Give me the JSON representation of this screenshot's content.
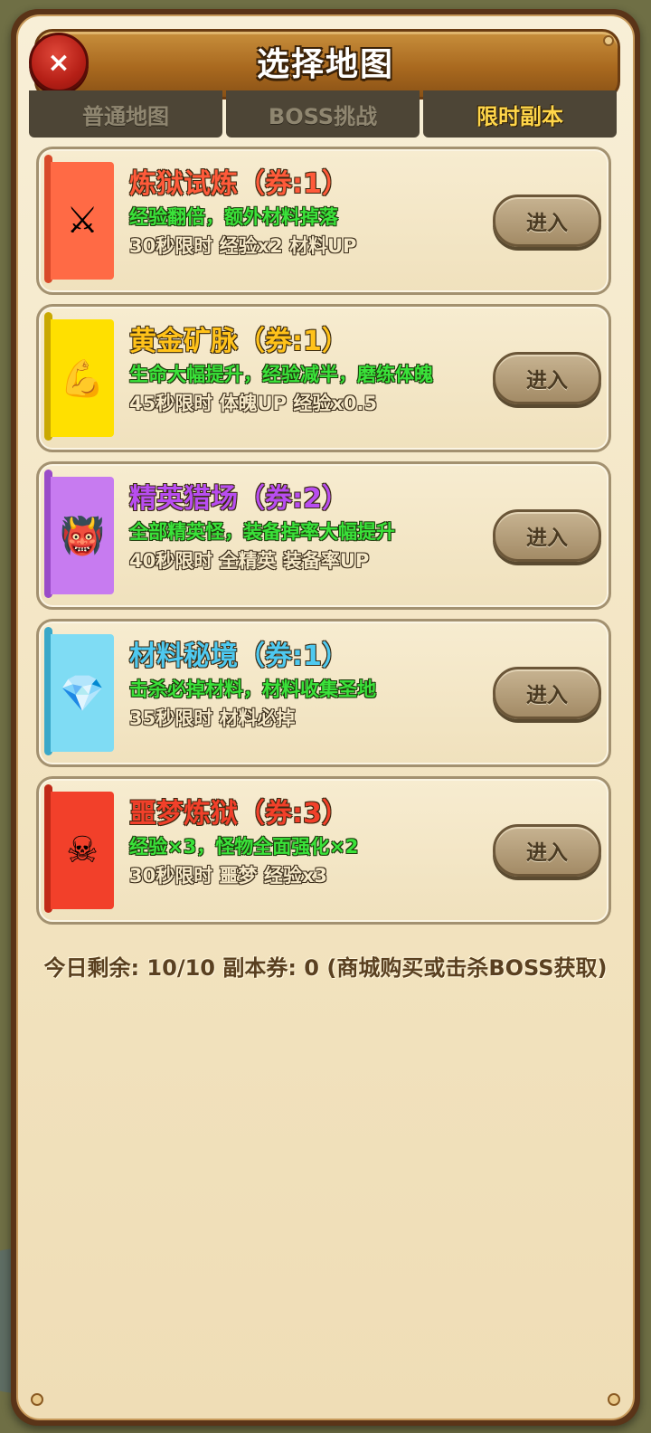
{
  "dialog": {
    "title": "选择地图",
    "close_symbol": "×"
  },
  "tabs": [
    {
      "label": "普通地图",
      "active": false
    },
    {
      "label": "BOSS挑战",
      "active": false
    },
    {
      "label": "限时副本",
      "active": true
    }
  ],
  "dungeons": [
    {
      "title": "炼狱试炼（券:1）",
      "title_color": "#ff5a3a",
      "banner_color": "#ff6a45",
      "stick_color": "#d84a2a",
      "icon": "crossed-swords-icon",
      "icon_glyph": "⚔",
      "description": "经验翻倍，额外材料掉落",
      "meta": "30秒限时 经验x2 材料UP",
      "enter_label": "进入"
    },
    {
      "title": "黄金矿脉（券:1）",
      "title_color": "#ffc21a",
      "banner_color": "#ffe000",
      "stick_color": "#c9a800",
      "icon": "flexed-arm-icon",
      "icon_glyph": "💪",
      "description": "生命大幅提升，经验减半，磨练体魄",
      "meta": "45秒限时 体魄UP 经验x0.5",
      "enter_label": "进入"
    },
    {
      "title": "精英猎场（券:2）",
      "title_color": "#b84df0",
      "banner_color": "#c77bf0",
      "stick_color": "#9a4cc8",
      "icon": "ogre-mask-icon",
      "icon_glyph": "👹",
      "description": "全部精英怪，装备掉率大幅提升",
      "meta": "40秒限时 全精英 装备率UP",
      "enter_label": "进入"
    },
    {
      "title": "材料秘境（券:1）",
      "title_color": "#4ec9f0",
      "banner_color": "#7fdcf4",
      "stick_color": "#3aa8c8",
      "icon": "gem-icon",
      "icon_glyph": "💎",
      "description": "击杀必掉材料，材料收集圣地",
      "meta": "35秒限时 材料必掉",
      "enter_label": "进入"
    },
    {
      "title": "噩梦炼狱（券:3）",
      "title_color": "#f2402a",
      "banner_color": "#f2402a",
      "stick_color": "#c02a18",
      "icon": "skull-crossbones-icon",
      "icon_glyph": "☠",
      "description": "经验×3，怪物全面强化×2",
      "meta": "30秒限时 噩梦 经验x3",
      "enter_label": "进入"
    }
  ],
  "footer": {
    "text": "今日剩余: 10/10 副本券: 0 (商城购买或击杀BOSS获取)"
  }
}
